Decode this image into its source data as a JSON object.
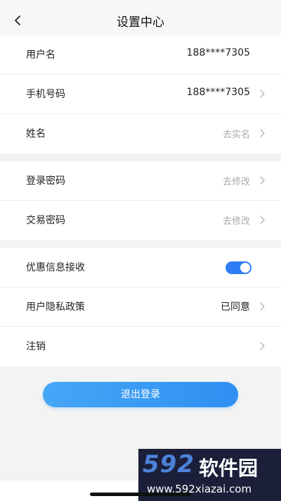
{
  "header": {
    "title": "设置中心",
    "back_icon": "chevron-left-icon"
  },
  "groups": [
    {
      "rows": [
        {
          "label": "用户名",
          "value": "188****7305",
          "chevron": false
        },
        {
          "label": "手机号码",
          "value": "188****7305",
          "chevron": true
        },
        {
          "label": "姓名",
          "value": "去实名",
          "chevron": true,
          "muted": true
        }
      ]
    },
    {
      "rows": [
        {
          "label": "登录密码",
          "value": "去修改",
          "chevron": true,
          "muted": true
        },
        {
          "label": "交易密码",
          "value": "去修改",
          "chevron": true,
          "muted": true
        }
      ]
    },
    {
      "rows": [
        {
          "label": "优惠信息接收",
          "toggle": true,
          "toggle_on": true
        },
        {
          "label": "用户隐私政策",
          "value": "已同意",
          "chevron": true
        },
        {
          "label": "注销",
          "value": "",
          "chevron": true
        }
      ]
    }
  ],
  "logout": {
    "label": "退出登录"
  },
  "watermark": {
    "logo": "592",
    "name": "软件园",
    "url": "www.592xiazai.com"
  },
  "colors": {
    "accent": "#2f7df6",
    "button_start": "#46a6f6",
    "button_end": "#2f8ff2"
  }
}
